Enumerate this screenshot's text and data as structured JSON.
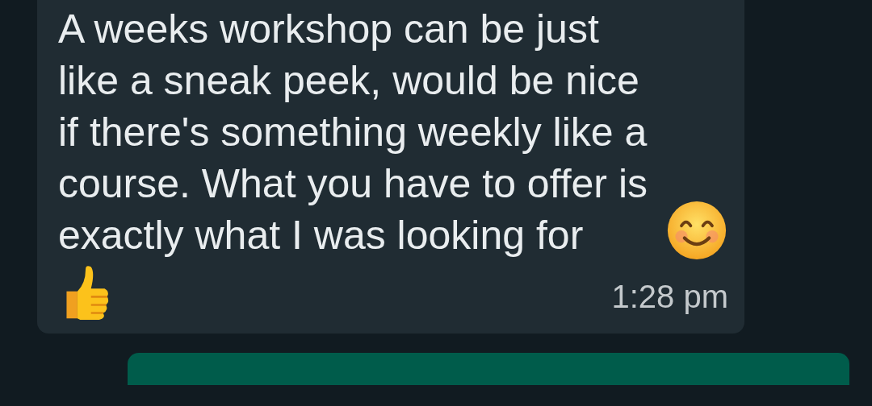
{
  "messages": [
    {
      "kind": "incoming",
      "text": "A weeks workshop can be just like a sneak peek, would be nice if there's something weekly like a course. What you have to offer is exactly what I was looking for",
      "time": "1:28 pm"
    },
    {
      "kind": "outgoing"
    }
  ]
}
